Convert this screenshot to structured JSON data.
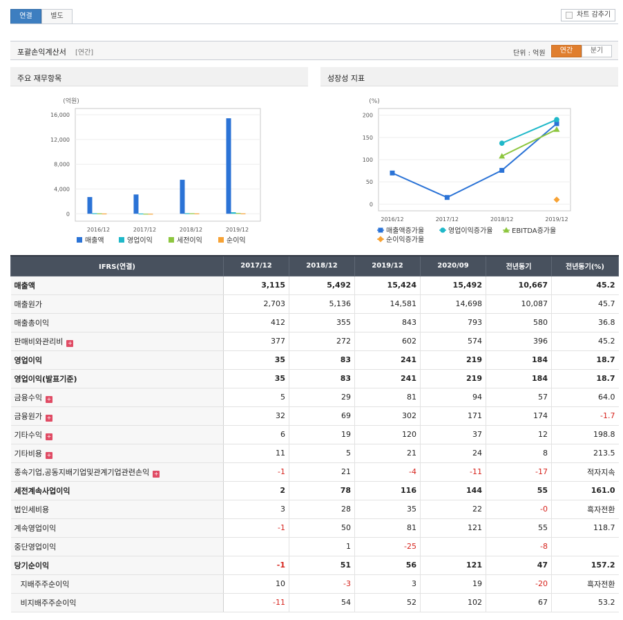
{
  "tabs": [
    {
      "label": "연결",
      "active": true
    },
    {
      "label": "별도",
      "active": false
    }
  ],
  "chart_toggle_label": "차트 감추기",
  "section": {
    "title": "포괄손익계산서",
    "subtitle": "[연간]",
    "unit_label": "단위 : 억원",
    "period_tabs": [
      {
        "label": "연간",
        "active": true
      },
      {
        "label": "분기",
        "active": false
      }
    ]
  },
  "left_chart": {
    "panel_title": "주요 재무항목",
    "chart_data": {
      "type": "bar",
      "ylabel": "(억원)",
      "categories": [
        "2016/12",
        "2017/12",
        "2018/12",
        "2019/12"
      ],
      "ylim": [
        -1200,
        17000
      ],
      "yticks": [
        "16,000",
        "12,000",
        "8,000",
        "4,000",
        "0"
      ],
      "ytick_values": [
        16000,
        12000,
        8000,
        4000,
        0
      ],
      "series": [
        {
          "name": "매출액",
          "color": "#2b73d6",
          "values": [
            2700,
            3115,
            5492,
            15424
          ]
        },
        {
          "name": "영업이익",
          "color": "#1fb8c9",
          "values": [
            80,
            35,
            83,
            241
          ]
        },
        {
          "name": "세전이익",
          "color": "#8dc63f",
          "values": [
            60,
            2,
            78,
            116
          ]
        },
        {
          "name": "순이익",
          "color": "#f7a234",
          "values": [
            40,
            -1,
            51,
            56
          ]
        }
      ]
    }
  },
  "right_chart": {
    "panel_title": "성장성 지표",
    "chart_data": {
      "type": "line",
      "ylabel": "(%)",
      "categories": [
        "2016/12",
        "2017/12",
        "2018/12",
        "2019/12"
      ],
      "ylim": [
        -15,
        215
      ],
      "yticks": [
        "200",
        "150",
        "100",
        "50",
        "0"
      ],
      "ytick_values": [
        200,
        150,
        100,
        50,
        0
      ],
      "series": [
        {
          "name": "매출액증가율",
          "color": "#2b73d6",
          "marker": "square",
          "values": [
            70,
            15,
            76,
            181
          ]
        },
        {
          "name": "영업이익증가율",
          "color": "#1fb8c9",
          "marker": "circle",
          "values": [
            null,
            null,
            137,
            190
          ]
        },
        {
          "name": "EBITDA증가율",
          "color": "#8dc63f",
          "marker": "triangle",
          "values": [
            null,
            null,
            108,
            168
          ]
        },
        {
          "name": "순이익증가율",
          "color": "#f7a234",
          "marker": "diamond",
          "values": [
            null,
            null,
            null,
            10
          ]
        }
      ]
    }
  },
  "table": {
    "headers": [
      "IFRS(연결)",
      "2017/12",
      "2018/12",
      "2019/12",
      "2020/09",
      "전년동기",
      "전년동기(%)"
    ],
    "rows": [
      {
        "label": "매출액",
        "bold": true,
        "grp": false,
        "plus": false,
        "indent": false,
        "values": [
          "3,115",
          "5,492",
          "15,424",
          "15,492",
          "10,667",
          "45.2"
        ]
      },
      {
        "label": "매출원가",
        "bold": false,
        "grp": false,
        "plus": false,
        "indent": false,
        "values": [
          "2,703",
          "5,136",
          "14,581",
          "14,698",
          "10,087",
          "45.7"
        ]
      },
      {
        "label": "매출총이익",
        "bold": false,
        "grp": false,
        "plus": false,
        "indent": false,
        "values": [
          "412",
          "355",
          "843",
          "793",
          "580",
          "36.8"
        ]
      },
      {
        "label": "판매비와관리비",
        "bold": false,
        "grp": false,
        "plus": true,
        "indent": false,
        "values": [
          "377",
          "272",
          "602",
          "574",
          "396",
          "45.2"
        ]
      },
      {
        "label": "영업이익",
        "bold": true,
        "grp": true,
        "plus": false,
        "indent": false,
        "values": [
          "35",
          "83",
          "241",
          "219",
          "184",
          "18.7"
        ]
      },
      {
        "label": "영업이익(발표기준)",
        "bold": true,
        "grp": false,
        "plus": false,
        "indent": false,
        "values": [
          "35",
          "83",
          "241",
          "219",
          "184",
          "18.7"
        ]
      },
      {
        "label": "금융수익",
        "bold": false,
        "grp": true,
        "plus": true,
        "indent": false,
        "values": [
          "5",
          "29",
          "81",
          "94",
          "57",
          "64.0"
        ]
      },
      {
        "label": "금융원가",
        "bold": false,
        "grp": false,
        "plus": true,
        "indent": false,
        "values": [
          "32",
          "69",
          "302",
          "171",
          "174",
          "-1.7"
        ]
      },
      {
        "label": "기타수익",
        "bold": false,
        "grp": false,
        "plus": true,
        "indent": false,
        "values": [
          "6",
          "19",
          "120",
          "37",
          "12",
          "198.8"
        ]
      },
      {
        "label": "기타비용",
        "bold": false,
        "grp": false,
        "plus": true,
        "indent": false,
        "values": [
          "11",
          "5",
          "21",
          "24",
          "8",
          "213.5"
        ]
      },
      {
        "label": "종속기업,공동지배기업및관계기업관련손익",
        "bold": false,
        "grp": false,
        "plus": true,
        "indent": false,
        "values": [
          "-1",
          "21",
          "-4",
          "-11",
          "-17",
          "적자지속"
        ]
      },
      {
        "label": "세전계속사업이익",
        "bold": true,
        "grp": true,
        "plus": false,
        "indent": false,
        "values": [
          "2",
          "78",
          "116",
          "144",
          "55",
          "161.0"
        ]
      },
      {
        "label": "법인세비용",
        "bold": false,
        "grp": false,
        "plus": false,
        "indent": false,
        "values": [
          "3",
          "28",
          "35",
          "22",
          "-0",
          "흑자전환"
        ]
      },
      {
        "label": "계속영업이익",
        "bold": false,
        "grp": false,
        "plus": false,
        "indent": false,
        "values": [
          "-1",
          "50",
          "81",
          "121",
          "55",
          "118.7"
        ]
      },
      {
        "label": "중단영업이익",
        "bold": false,
        "grp": false,
        "plus": false,
        "indent": false,
        "values": [
          "",
          "1",
          "-25",
          "",
          "-8",
          ""
        ]
      },
      {
        "label": "당기순이익",
        "bold": true,
        "grp": true,
        "plus": false,
        "indent": false,
        "values": [
          "-1",
          "51",
          "56",
          "121",
          "47",
          "157.2"
        ]
      },
      {
        "label": "지배주주순이익",
        "bold": false,
        "grp": false,
        "plus": false,
        "indent": true,
        "values": [
          "10",
          "-3",
          "3",
          "19",
          "-20",
          "흑자전환"
        ]
      },
      {
        "label": "비지배주주순이익",
        "bold": false,
        "grp": false,
        "plus": false,
        "indent": true,
        "values": [
          "-11",
          "54",
          "52",
          "102",
          "67",
          "53.2"
        ]
      }
    ]
  }
}
